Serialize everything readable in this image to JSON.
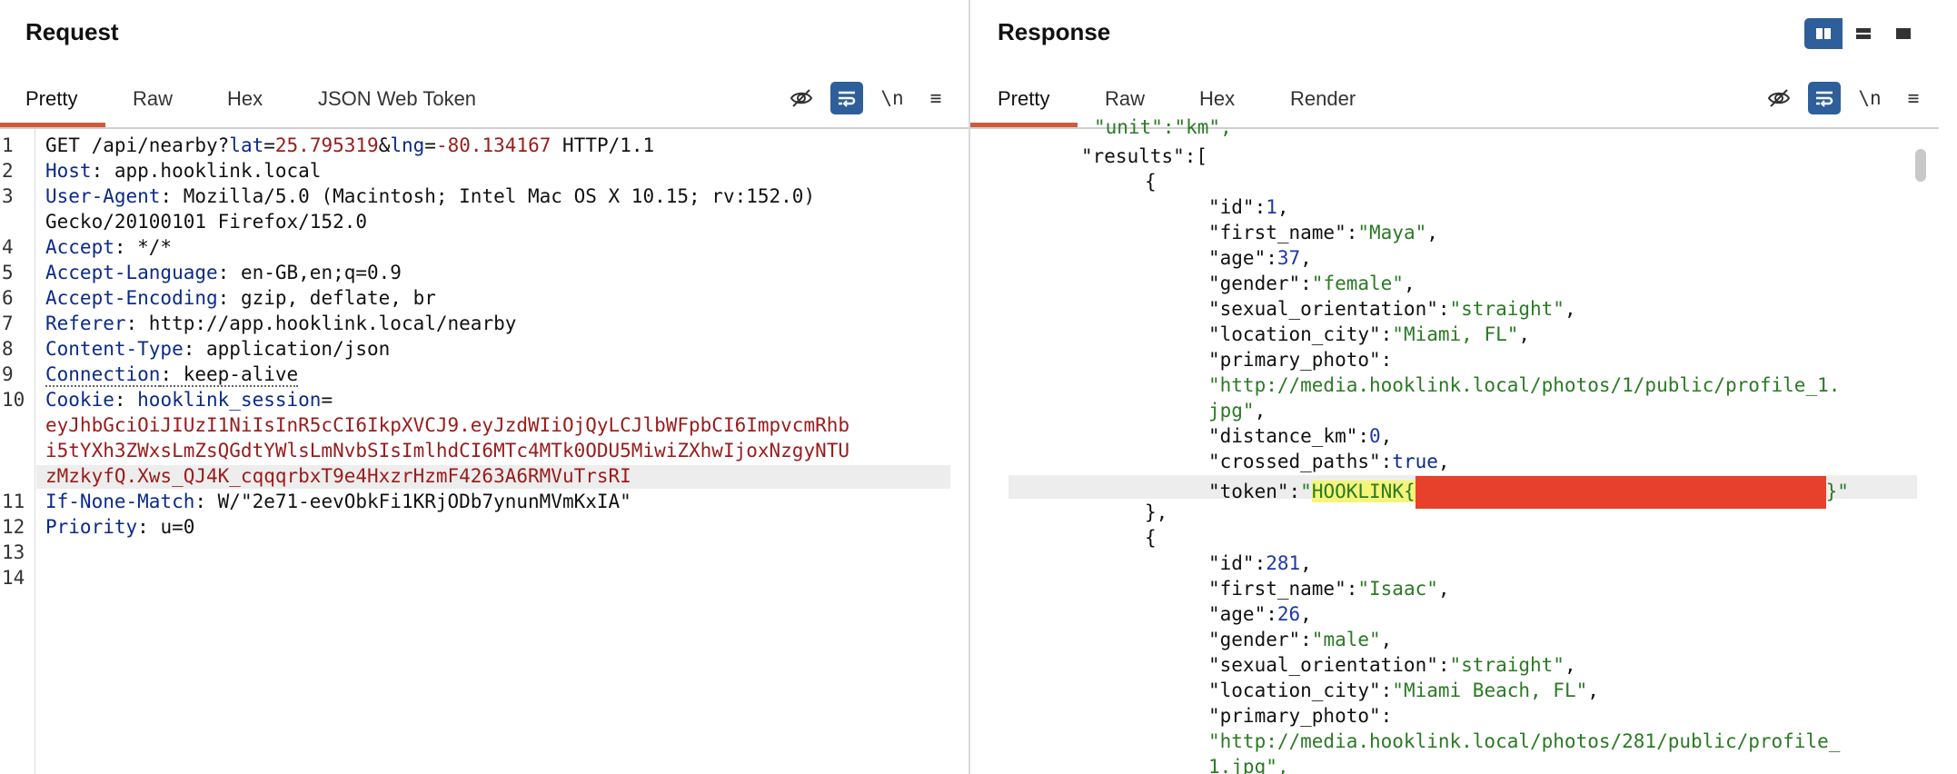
{
  "request": {
    "title": "Request",
    "tabs": [
      "Pretty",
      "Raw",
      "Hex",
      "JSON Web Token"
    ],
    "tools": {
      "wrap": "\\n",
      "menu": "≡"
    },
    "line_numbers": [
      "1",
      "2",
      "3",
      "",
      "4",
      "5",
      "6",
      "7",
      "8",
      "9",
      "10",
      "",
      "",
      "11",
      "12",
      "13",
      "14"
    ],
    "lines": {
      "l1": {
        "method": "GET /api/nearby?",
        "lat_key": "lat",
        "eq1": "=",
        "lat_val": "25.795319",
        "amp": "&",
        "lng_key": "lng",
        "eq2": "=",
        "lng_val": "-80.134167",
        "proto": " HTTP/1.1"
      },
      "l2": {
        "key": "Host",
        "val": ": app.hooklink.local"
      },
      "l3a": {
        "key": "User-Agent",
        "val": ": Mozilla/5.0 (Macintosh; Intel Mac OS X 10.15; rv:152.0)"
      },
      "l3b": {
        "val": "Gecko/20100101 Firefox/152.0"
      },
      "l4": {
        "key": "Accept",
        "val": ": */*"
      },
      "l5": {
        "key": "Accept-Language",
        "val": ": en-GB,en;q=0.9"
      },
      "l6": {
        "key": "Accept-Encoding",
        "val": ": gzip, deflate, br"
      },
      "l7": {
        "key": "Referer",
        "val": ": http://app.hooklink.local/nearby"
      },
      "l8": {
        "key": "Content-Type",
        "val": ": application/json"
      },
      "l9": {
        "key": "Connection",
        "val": ": keep-alive"
      },
      "l10a": {
        "key": "Cookie",
        "sep": ": ",
        "cookie_name": "hooklink_session",
        "eq": "="
      },
      "l10b": "eyJhbGciOiJIUzI1NiIsInR5cCI6IkpXVCJ9.eyJzdWIiOjQyLCJlbWFpbCI6ImpvcmRhb",
      "l10c": "i5tYXh3ZWxsLmZsQGdtYWlsLmNvbSIsImlhdCI6MTc4MTk0ODU5MiwiZXhwIjoxNzgyNTU",
      "l10d": "zMzkyfQ.Xws_QJ4K_cqqqrbxT9e4HxzrHzmF4263A6RMVuTrsRI",
      "l11": {
        "key": "If-None-Match",
        "val": ": W/\"2e71-eevObkFi1KRjODb7ynunMVmKxIA\""
      },
      "l12": {
        "key": "Priority",
        "val": ": u=0"
      }
    }
  },
  "response": {
    "title": "Response",
    "tabs": [
      "Pretty",
      "Raw",
      "Hex",
      "Render"
    ],
    "tools": {
      "wrap": "\\n",
      "menu": "≡"
    },
    "lines": {
      "top_partial": "\"unit\":\"km\",",
      "results_key": "\"results\":[",
      "open1": "{",
      "r1": {
        "id_k": "\"id\":",
        "id_v": "1",
        "c": ",",
        "fn_k": "\"first_name\":",
        "fn_v": "\"Maya\"",
        "age_k": "\"age\":",
        "age_v": "37",
        "g_k": "\"gender\":",
        "g_v": "\"female\"",
        "so_k": "\"sexual_orientation\":",
        "so_v": "\"straight\"",
        "lc_k": "\"location_city\":",
        "lc_v": "\"Miami, FL\"",
        "pp_k": "\"primary_photo\":",
        "pp_v1": "\"http://media.hooklink.local/photos/1/public/profile_1.",
        "pp_v2": "jpg\"",
        "dk_k": "\"distance_km\":",
        "dk_v": "0",
        "cp_k": "\"crossed_paths\":",
        "cp_v": "true",
        "tk_k": "\"token\":",
        "tk_q": "\"",
        "tk_v": "HOOKLINK{",
        "tk_end": "}\""
      },
      "close1": "},",
      "open2": "{",
      "r2": {
        "id_k": "\"id\":",
        "id_v": "281",
        "c": ",",
        "fn_k": "\"first_name\":",
        "fn_v": "\"Isaac\"",
        "age_k": "\"age\":",
        "age_v": "26",
        "g_k": "\"gender\":",
        "g_v": "\"male\"",
        "so_k": "\"sexual_orientation\":",
        "so_v": "\"straight\"",
        "lc_k": "\"location_city\":",
        "lc_v": "\"Miami Beach, FL\"",
        "pp_k": "\"primary_photo\":",
        "pp_v1": "\"http://media.hooklink.local/photos/281/public/profile_",
        "pp_v2": "1.jpg\","
      }
    }
  },
  "colors": {
    "accent": "#d35a36",
    "toggle_blue": "#2f5f9a",
    "string_green": "#2a7a24",
    "number_blue": "#1b38a8",
    "param_red": "#9a1b1b",
    "redaction": "#e8412b",
    "highlight": "#f5f57a"
  }
}
